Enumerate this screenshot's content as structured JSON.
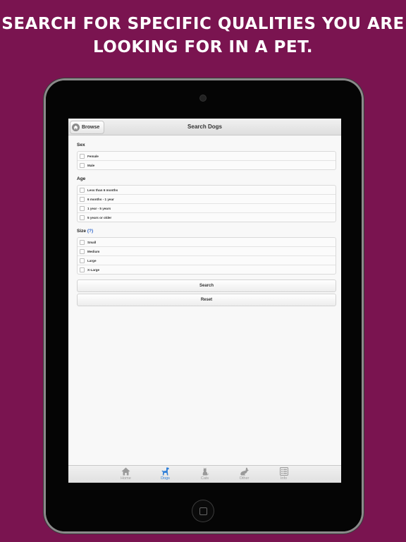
{
  "headline": {
    "line1": "SEARCH FOR SPECIFIC QUALITIES YOU ARE",
    "line2": "LOOKING FOR IN A PET."
  },
  "navbar": {
    "back_label": "Browse",
    "title": "Search Dogs"
  },
  "sections": {
    "sex": {
      "label": "Sex",
      "options": [
        "Female",
        "Male"
      ]
    },
    "age": {
      "label": "Age",
      "options": [
        "Less than 6 months",
        "6 months - 1 year",
        "1 year - 5 years",
        "5 years or older"
      ]
    },
    "size": {
      "label": "Size",
      "help": "(?)",
      "options": [
        "Small",
        "Medium",
        "Large",
        "X-Large"
      ]
    }
  },
  "buttons": {
    "search": "Search",
    "reset": "Reset"
  },
  "tabs": [
    {
      "label": "Home",
      "icon": "home-icon"
    },
    {
      "label": "Dogs",
      "icon": "dog-icon",
      "active": true
    },
    {
      "label": "Cats",
      "icon": "cat-icon"
    },
    {
      "label": "Other",
      "icon": "rabbit-icon"
    },
    {
      "label": "Info",
      "icon": "info-list-icon"
    }
  ],
  "colors": {
    "background": "#7a1450",
    "tab_active": "#2f7fd8",
    "tab_inactive": "#9a9a9a",
    "help_link": "#2a62c9"
  }
}
